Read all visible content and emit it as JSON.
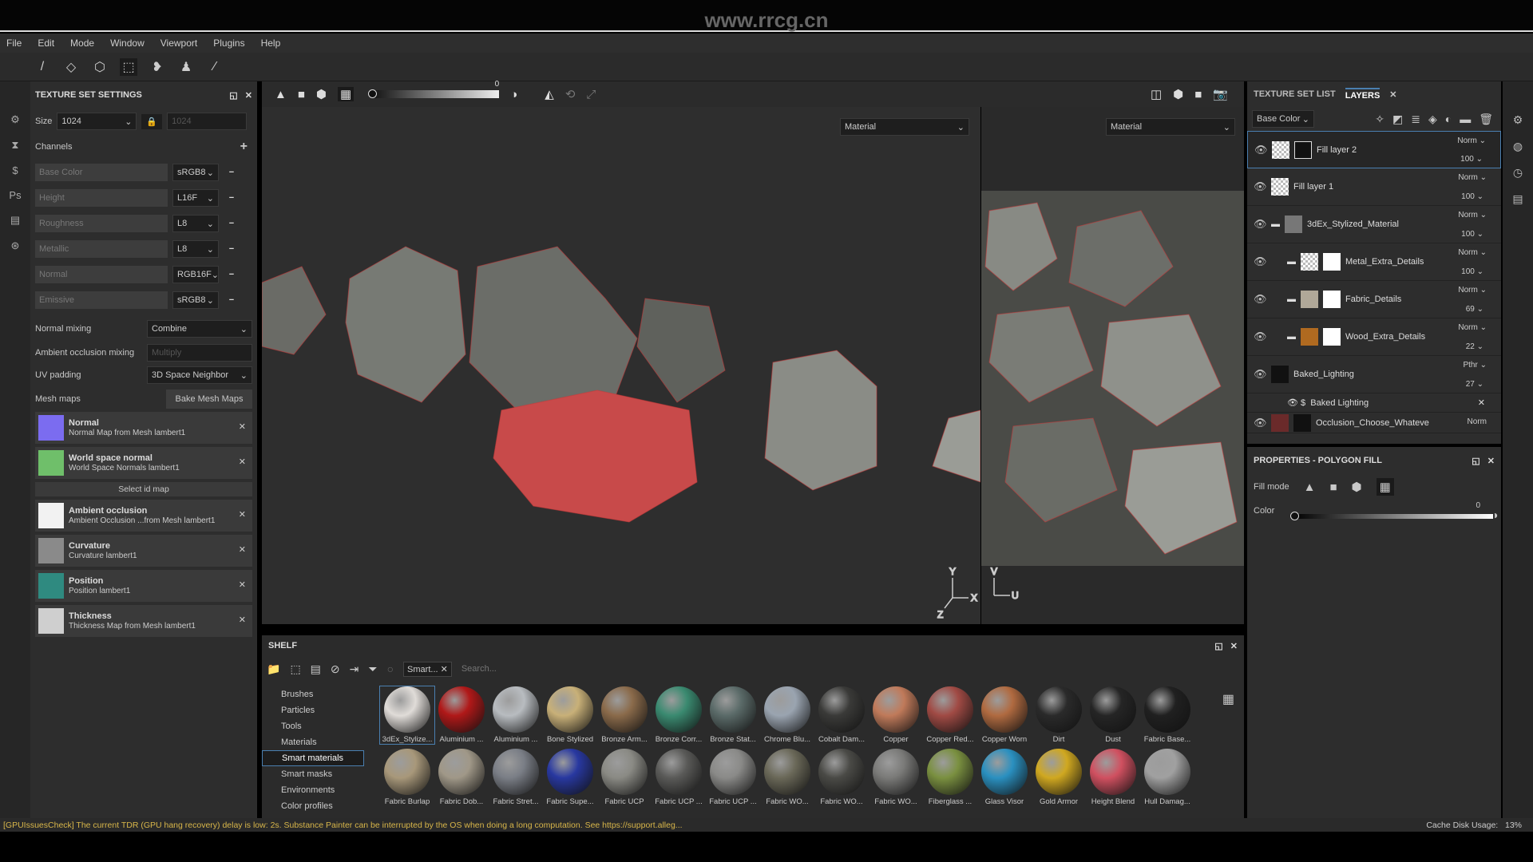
{
  "watermark": "www.rrcg.cn",
  "menu": [
    "File",
    "Edit",
    "Mode",
    "Window",
    "Viewport",
    "Plugins",
    "Help"
  ],
  "tools": [
    {
      "icon": "paint-brush-icon",
      "g": "/"
    },
    {
      "icon": "eraser-icon",
      "g": "◇"
    },
    {
      "icon": "projection-icon",
      "g": "⬡"
    },
    {
      "icon": "polygon-fill-icon",
      "g": "⬚"
    },
    {
      "icon": "smudge-icon",
      "g": "❥"
    },
    {
      "icon": "clone-stamp-icon",
      "g": "♟"
    },
    {
      "icon": "color-picker-icon",
      "g": "∕"
    }
  ],
  "texture_set_settings": {
    "title": "TEXTURE SET SETTINGS",
    "size_label": "Size",
    "size": "1024",
    "size_linked": "1024",
    "channels_label": "Channels",
    "channels": [
      {
        "name": "Base Color",
        "format": "sRGB8"
      },
      {
        "name": "Height",
        "format": "L16F"
      },
      {
        "name": "Roughness",
        "format": "L8"
      },
      {
        "name": "Metallic",
        "format": "L8"
      },
      {
        "name": "Normal",
        "format": "RGB16F"
      },
      {
        "name": "Emissive",
        "format": "sRGB8"
      }
    ],
    "normal_mixing_label": "Normal mixing",
    "normal_mixing": "Combine",
    "ao_mixing_label": "Ambient occlusion mixing",
    "ao_mixing": "Multiply",
    "uv_padding_label": "UV padding",
    "uv_padding": "3D Space Neighbor",
    "mesh_maps_label": "Mesh maps",
    "bake_button": "Bake Mesh Maps",
    "select_id": "Select id map",
    "mesh_maps": [
      {
        "title": "Normal",
        "sub": "Normal Map from Mesh lambert1",
        "color": "#7b6cf0"
      },
      {
        "title": "World space normal",
        "sub": "World Space Normals lambert1",
        "color": "#6fbf6a"
      },
      {
        "title": "Ambient occlusion",
        "sub": "Ambient Occlusion ...from Mesh lambert1",
        "color": "#f2f2f2"
      },
      {
        "title": "Curvature",
        "sub": "Curvature lambert1",
        "color": "#8a8a8a"
      },
      {
        "title": "Position",
        "sub": "Position lambert1",
        "color": "#2f8a80"
      },
      {
        "title": "Thickness",
        "sub": "Thickness Map from Mesh lambert1",
        "color": "#cfcfcf"
      }
    ]
  },
  "viewport": {
    "opacity_value": "0",
    "mode_left": "Material",
    "mode_right": "Material",
    "axis_3d": [
      "Y",
      "X",
      "Z"
    ],
    "axis_2d": [
      "V",
      "U"
    ]
  },
  "shelf": {
    "title": "SHELF",
    "filter_tag": "Smart...",
    "search_placeholder": "Search...",
    "categories": [
      "Brushes",
      "Particles",
      "Tools",
      "Materials",
      "Smart materials",
      "Smart masks",
      "Environments",
      "Color profiles"
    ],
    "selected_category": "Smart materials",
    "materials": [
      {
        "n": "3dEx_Stylize...",
        "c": "#e0dcd8"
      },
      {
        "n": "Aluminium ...",
        "c": "#b01818"
      },
      {
        "n": "Aluminium ...",
        "c": "#b8bcc0"
      },
      {
        "n": "Bone Stylized",
        "c": "#c8b078"
      },
      {
        "n": "Bronze Arm...",
        "c": "#8a6a4a"
      },
      {
        "n": "Bronze Corr...",
        "c": "#3a8a70"
      },
      {
        "n": "Bronze Stat...",
        "c": "#5a6a68"
      },
      {
        "n": "Chrome Blu...",
        "c": "#9aa4b0"
      },
      {
        "n": "Cobalt Dam...",
        "c": "#3a3a38"
      },
      {
        "n": "Copper",
        "c": "#c07a5a"
      },
      {
        "n": "Copper Red...",
        "c": "#a04a44"
      },
      {
        "n": "Copper Worn",
        "c": "#b06a40"
      },
      {
        "n": "Dirt",
        "c": "#2a2a2a"
      },
      {
        "n": "Dust",
        "c": "#252525"
      },
      {
        "n": "Fabric Base...",
        "c": "#202020"
      },
      {
        "n": "Fabric Burlap",
        "c": "#a8987a"
      },
      {
        "n": "Fabric Dob...",
        "c": "#a09888"
      },
      {
        "n": "Fabric Stret...",
        "c": "#7a7e86"
      },
      {
        "n": "Fabric Supe...",
        "c": "#2838a0"
      },
      {
        "n": "Fabric UCP",
        "c": "#8a8a84"
      },
      {
        "n": "Fabric UCP ...",
        "c": "#5a5a58"
      },
      {
        "n": "Fabric UCP ...",
        "c": "#8a8a88"
      },
      {
        "n": "Fabric WO...",
        "c": "#6a6858"
      },
      {
        "n": "Fabric WO...",
        "c": "#4a4a46"
      },
      {
        "n": "Fabric WO...",
        "c": "#7a7a78"
      },
      {
        "n": "Fiberglass ...",
        "c": "#7a9040"
      },
      {
        "n": "Glass Visor",
        "c": "#2a90c0"
      },
      {
        "n": "Gold Armor",
        "c": "#d0a820"
      },
      {
        "n": "Height Blend",
        "c": "#d05060"
      },
      {
        "n": "Hull Damag...",
        "c": "#a0a0a0"
      }
    ]
  },
  "layers_panel": {
    "tab_texture_set": "TEXTURE SET LIST",
    "tab_layers": "LAYERS",
    "channel": "Base Color",
    "layers": [
      {
        "name": "Fill layer 2",
        "blend": "Norm",
        "opacity": "100",
        "indent": 0,
        "folder": false,
        "thumb": "checker",
        "mask": true,
        "selected": true
      },
      {
        "name": "Fill layer 1",
        "blend": "Norm",
        "opacity": "100",
        "indent": 0,
        "folder": false,
        "thumb": "checker",
        "mask": false
      },
      {
        "name": "3dEx_Stylized_Material",
        "blend": "Norm",
        "opacity": "100",
        "indent": 0,
        "folder": true,
        "thumb": "#777"
      },
      {
        "name": "Metal_Extra_Details",
        "blend": "Norm",
        "opacity": "100",
        "indent": 1,
        "folder": true,
        "thumb": "checker",
        "mask": true
      },
      {
        "name": "Fabric_Details",
        "blend": "Norm",
        "opacity": "69",
        "indent": 1,
        "folder": true,
        "thumb": "#b0a898",
        "mask": true
      },
      {
        "name": "Wood_Extra_Details",
        "blend": "Norm",
        "opacity": "22",
        "indent": 1,
        "folder": true,
        "thumb": "#b06a20",
        "mask": true
      },
      {
        "name": "Baked_Lighting",
        "blend": "Pthr",
        "opacity": "27",
        "indent": 0,
        "folder": false,
        "thumb": "#111"
      }
    ],
    "effect": "Baked Lighting",
    "last_layer": "Occlusion_Choose_Whateve",
    "last_blend": "Norm"
  },
  "properties": {
    "title": "PROPERTIES - POLYGON FILL",
    "fill_mode_label": "Fill mode",
    "color_label": "Color",
    "color_value": "0"
  },
  "status": {
    "message": "[GPUIssuesCheck] The current TDR (GPU hang recovery) delay is low: 2s. Substance Painter can be interrupted by the OS when doing a long computation. See https://support.alleg...",
    "cache_label": "Cache Disk Usage:",
    "cache_value": "13%"
  },
  "colors": {
    "accent": "#4a7fb0",
    "status_text": "#d8b64a",
    "mesh_highlight": "#c83a3a"
  }
}
